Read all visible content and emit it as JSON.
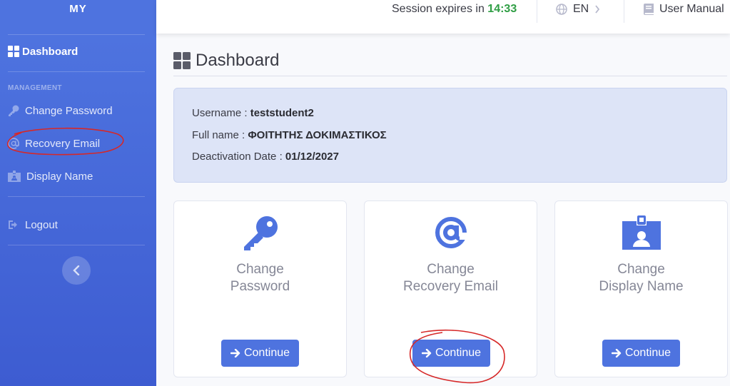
{
  "sidebar": {
    "brand": "MY",
    "dashboard_label": "Dashboard",
    "section_heading": "MANAGEMENT",
    "items": [
      {
        "label": "Change Password",
        "icon": "key-icon"
      },
      {
        "label": "Recovery Email",
        "icon": "at-icon"
      },
      {
        "label": "Display Name",
        "icon": "id-badge-icon"
      }
    ],
    "logout_label": "Logout"
  },
  "topbar": {
    "session_prefix": "Session expires in",
    "session_timer": "14:33",
    "language": "EN",
    "manual_label": "User Manual"
  },
  "page": {
    "title": "Dashboard"
  },
  "info": {
    "username_label": "Username :",
    "username_value": "teststudent2",
    "fullname_label": "Full name :",
    "fullname_value": "ΦΟΙΤΗΤΗΣ ΔΟΚΙΜΑΣΤΙΚΟΣ",
    "deactivation_label": "Deactivation Date :",
    "deactivation_value": "01/12/2027"
  },
  "cards": [
    {
      "line1": "Change",
      "line2": "Password",
      "button": "Continue",
      "icon": "key-icon"
    },
    {
      "line1": "Change",
      "line2": "Recovery Email",
      "button": "Continue",
      "icon": "at-icon"
    },
    {
      "line1": "Change",
      "line2": "Display Name",
      "button": "Continue",
      "icon": "id-badge-icon"
    }
  ],
  "colors": {
    "primary": "#4e73df",
    "timer": "#2f9e44",
    "annotation": "#d62828"
  }
}
